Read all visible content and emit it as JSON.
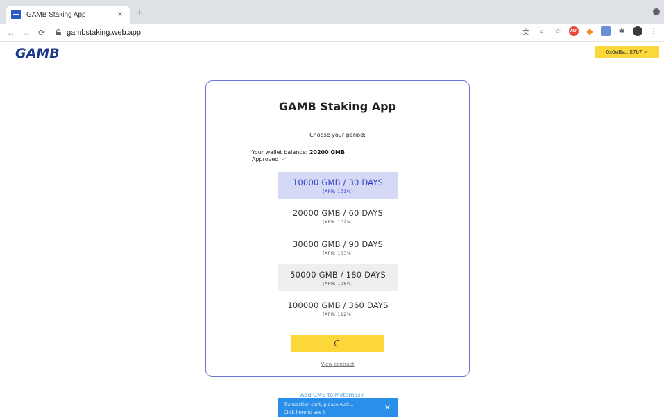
{
  "browser": {
    "tab_title": "GAMB Staking App",
    "tab_close": "×",
    "new_tab": "+",
    "url": "gambstaking.web.app"
  },
  "header": {
    "logo": "GAMB",
    "wallet_label": "0x0eBa...57b7 ✓"
  },
  "card": {
    "title": "GAMB Staking App",
    "choose": "Choose your period:",
    "balance_prefix": "Your wallet balance: ",
    "balance_value": "20200 GMB",
    "approved": "Approved",
    "approved_check": "✓",
    "options": [
      {
        "label": "10000 GMB / 30 DAYS",
        "apr": "(APR: 101%)",
        "state": "selected"
      },
      {
        "label": "20000 GMB / 60 DAYS",
        "apr": "(APR: 102%)",
        "state": "normal"
      },
      {
        "label": "30000 GMB / 90 DAYS",
        "apr": "(APR: 103%)",
        "state": "normal"
      },
      {
        "label": "50000 GMB / 180 DAYS",
        "apr": "(APR: 106%)",
        "state": "hover"
      },
      {
        "label": "100000 GMB / 360 DAYS",
        "apr": "(APR: 112%)",
        "state": "normal"
      }
    ],
    "view_contract": "View contract"
  },
  "add_metamask": "Add GMB to Metamask",
  "toast": {
    "line1": "Transaction sent, please wait...",
    "line2": "Click here to see it",
    "close": "✕"
  },
  "colors": {
    "accent_yellow": "#fcd73a",
    "card_border": "#6e73d8",
    "selected_bg": "#d5d9f5",
    "toast_blue": "#2a8fe8",
    "logo_blue": "#1d3a8a"
  }
}
